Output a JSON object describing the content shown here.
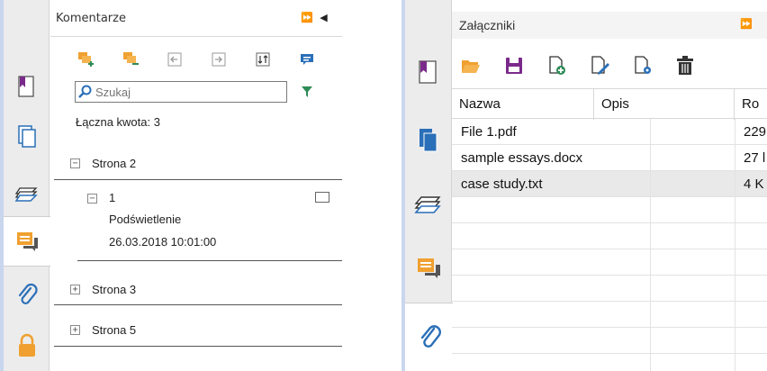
{
  "comments_panel": {
    "title": "Komentarze",
    "header_buttons": "⏩ ◀",
    "search_placeholder": "Szukaj",
    "total_label": "Łączna kwota: 3",
    "groups": [
      {
        "label": "Strona 2",
        "expanded": true,
        "items": [
          {
            "number": "1",
            "type": "Podświetlenie",
            "datetime": "26.03.2018 10:01:00"
          }
        ]
      },
      {
        "label": "Strona 3",
        "expanded": false
      },
      {
        "label": "Strona 5",
        "expanded": false
      }
    ]
  },
  "attachments_panel": {
    "title": "Załączniki",
    "header_buttons": "⏩",
    "columns": [
      "Nazwa",
      "Opis",
      "Ro"
    ],
    "rows": [
      {
        "name": "File 1.pdf",
        "desc": "",
        "size": "229"
      },
      {
        "name": "sample essays.docx",
        "desc": "",
        "size": "27 l"
      },
      {
        "name": "case study.txt",
        "desc": "",
        "size": "4 K"
      }
    ]
  },
  "colors": {
    "accent_orange": "#f0a030",
    "icon_green": "#2e8b57",
    "icon_blue": "#2a6fb8",
    "purple": "#7a2a8a"
  }
}
